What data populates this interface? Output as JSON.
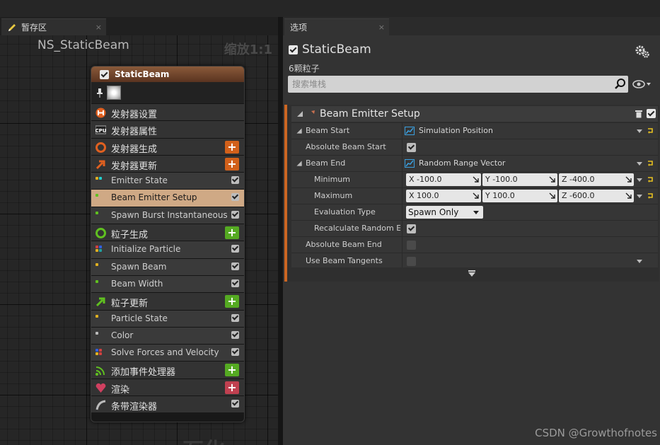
{
  "left_tab": {
    "label": "暂存区",
    "close": "×"
  },
  "graph": {
    "title": "NS_StaticBeam",
    "zoom": "缩放1:1",
    "watermark": "石化"
  },
  "node": {
    "title": "StaticBeam",
    "rows": [
      {
        "label": "发射器设置",
        "kind": "section"
      },
      {
        "label": "发射器属性",
        "kind": "section"
      },
      {
        "label": "发射器生成",
        "kind": "section",
        "button": "+"
      },
      {
        "label": "发射器更新",
        "kind": "section",
        "button": "+"
      },
      {
        "label": "Emitter State",
        "kind": "module"
      },
      {
        "label": "Beam Emitter Setup",
        "kind": "module",
        "selected": true
      },
      {
        "label": "Spawn Burst Instantaneous",
        "kind": "module"
      },
      {
        "label": "粒子生成",
        "kind": "section",
        "button": "+"
      },
      {
        "label": "Initialize Particle",
        "kind": "module"
      },
      {
        "label": "Spawn Beam",
        "kind": "module"
      },
      {
        "label": "Beam Width",
        "kind": "module"
      },
      {
        "label": "粒子更新",
        "kind": "section",
        "button": "+"
      },
      {
        "label": "Particle State",
        "kind": "module"
      },
      {
        "label": "Color",
        "kind": "module"
      },
      {
        "label": "Solve Forces and Velocity",
        "kind": "module"
      },
      {
        "label": "添加事件处理器",
        "kind": "section",
        "button": "+"
      },
      {
        "label": "渲染",
        "kind": "section",
        "button": "+"
      },
      {
        "label": "条带渲染器",
        "kind": "section"
      }
    ],
    "cpu_label": "CPU"
  },
  "right_tab": {
    "label": "选项",
    "close": "×"
  },
  "props": {
    "title": "StaticBeam",
    "particle_count": "6颗粒子",
    "search_placeholder": "搜索堆栈",
    "module_title": "Beam Emitter Setup",
    "beam_start": {
      "name": "Beam Start",
      "value": "Simulation Position"
    },
    "absolute_beam_start": {
      "name": "Absolute Beam Start",
      "checked": true
    },
    "beam_end": {
      "name": "Beam End",
      "value": "Random Range Vector"
    },
    "minimum": {
      "name": "Minimum",
      "x": "X  -100.0",
      "y": "Y  -100.0",
      "z": "Z  -400.0"
    },
    "maximum": {
      "name": "Maximum",
      "x": "X  100.0",
      "y": "Y  100.0",
      "z": "Z  -600.0"
    },
    "evaluation_type": {
      "name": "Evaluation Type",
      "value": "Spawn Only"
    },
    "recalculate": {
      "name": "Recalculate Random Ea",
      "checked": true
    },
    "absolute_beam_end": {
      "name": "Absolute Beam End",
      "checked": false
    },
    "use_beam_tangents": {
      "name": "Use Beam Tangents",
      "checked": false
    }
  },
  "footer": {
    "watermark": "CSDN @Growthofnotes"
  },
  "colors": {
    "accent": "#cc6622",
    "selected": "#cfa985",
    "add_orange": "#d2601a",
    "add_green": "#55aa22",
    "add_red": "#c04050"
  }
}
